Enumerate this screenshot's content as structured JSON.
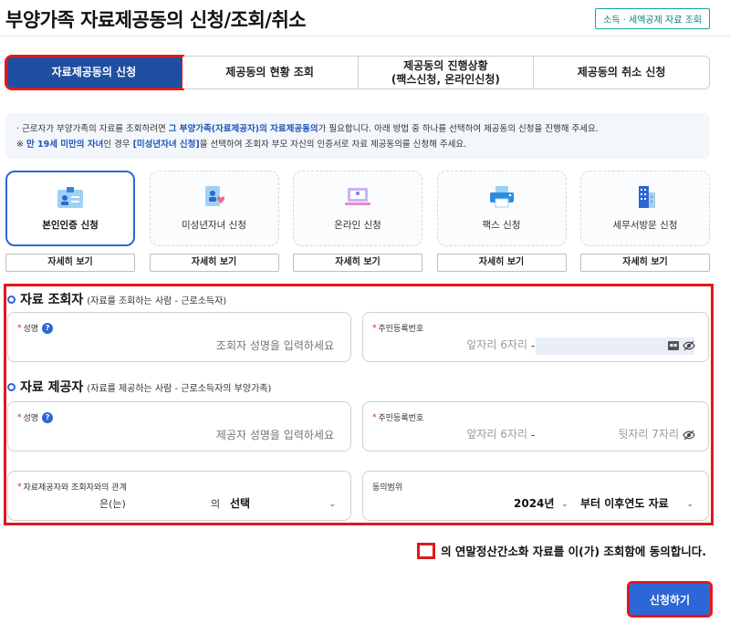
{
  "header": {
    "title": "부양가족 자료제공동의 신청/조회/취소",
    "top_link": "소득 · 세액공제 자료 조회"
  },
  "tabs": [
    {
      "label": "자료제공동의 신청",
      "active": true
    },
    {
      "label": "제공동의 현황 조회",
      "active": false
    },
    {
      "label": "제공동의 진행상황",
      "label2": "(팩스신청, 온라인신청)",
      "active": false
    },
    {
      "label": "제공동의 취소 신청",
      "active": false
    }
  ],
  "notice": {
    "line1_a": "· 근로자가 부양가족의 자료를 조회하려면 ",
    "line1_hl": "그 부양가족(자료제공자)의 자료제공동의",
    "line1_b": "가 필요합니다. 아래 방법 중 하나를 선택하여 제공동의 신청을 진행해 주세요.",
    "line2_a": "※ ",
    "line2_hl1": "만 19세 미만의 자녀",
    "line2_b": "인 경우 ",
    "line2_hl2": "[미성년자녀 신청]",
    "line2_c": "을 선택하여 조회자 부모 자신의 인증서로 자료 제공동의를 신청해 주세요."
  },
  "methods": [
    {
      "label": "본인인증 신청",
      "icon": "id-card-icon",
      "detail": "자세히 보기",
      "active": true
    },
    {
      "label": "미성년자녀 신청",
      "icon": "child-heart-icon",
      "detail": "자세히 보기",
      "active": false
    },
    {
      "label": "온라인 신청",
      "icon": "laptop-icon",
      "detail": "자세히 보기",
      "active": false
    },
    {
      "label": "팩스 신청",
      "icon": "printer-icon",
      "detail": "자세히 보기",
      "active": false
    },
    {
      "label": "세무서방문 신청",
      "icon": "building-icon",
      "detail": "자세히 보기",
      "active": false
    }
  ],
  "inquirer": {
    "title": "자료 조회자",
    "subtitle": "(자료를 조회하는 사람 - 근로소득자)",
    "name_label": "성명",
    "name_placeholder": "조회자 성명을 입력하세요",
    "ssn_label": "주민등록번호",
    "ssn_front_placeholder": "앞자리 6자리",
    "ssn_dash": "-"
  },
  "provider": {
    "title": "자료 제공자",
    "subtitle": "(자료를 제공하는 사람 - 근로소득자의 부양가족)",
    "name_label": "성명",
    "name_placeholder": "제공자 성명을 입력하세요",
    "ssn_label": "주민등록번호",
    "ssn_front_placeholder": "앞자리 6자리",
    "ssn_dash": "-",
    "ssn_back_placeholder": "뒷자리 7자리",
    "relation_label": "자료제공자와 조회자와의 관계",
    "relation_suffix1": "은(는)",
    "relation_suffix2": "의",
    "relation_value": "선택",
    "scope_label": "동의범위",
    "scope_year": "2024년",
    "scope_value": "부터 이후연도 자료"
  },
  "agreement": {
    "text": "의 연말정산간소화 자료를 이(가) 조회함에 동의합니다."
  },
  "submit_label": "신청하기",
  "colors": {
    "accent": "#2d66d6",
    "tab_active": "#1f4fa0",
    "highlight": "#e0191e"
  }
}
